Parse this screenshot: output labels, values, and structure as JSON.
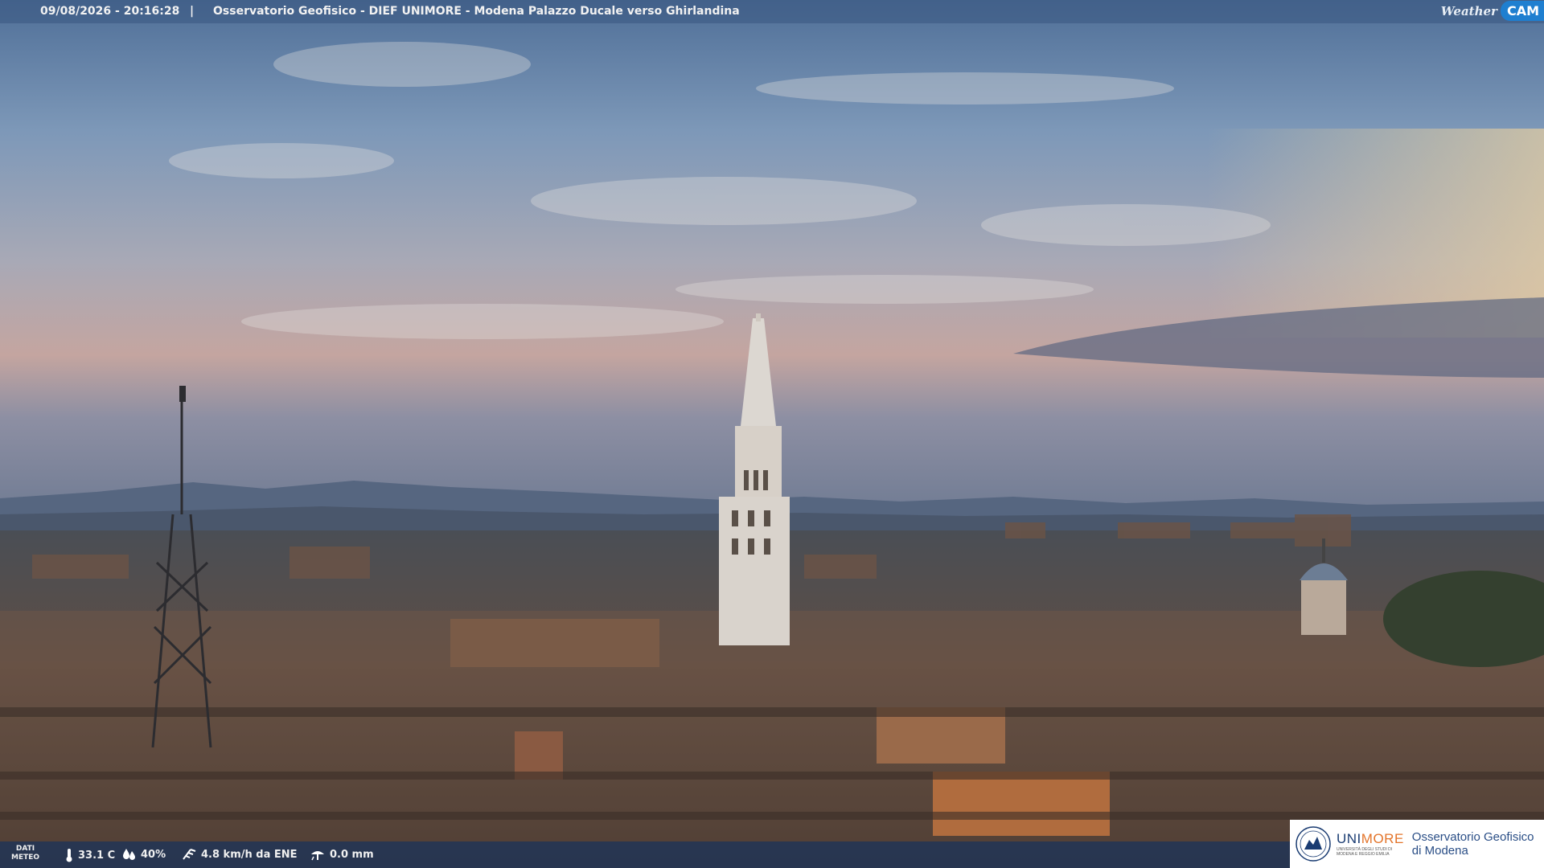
{
  "header": {
    "timestamp": "09/08/2026 - 20:16:28",
    "separator": "|",
    "title": "Osservatorio Geofisico - DIEF UNIMORE - Modena Palazzo Ducale verso Ghirlandina",
    "brand_word": "Weather",
    "brand_cam": "CAM"
  },
  "weather": {
    "label_line1": "DATI",
    "label_line2": "METEO",
    "temperature": "33.1 C",
    "humidity": "40%",
    "wind": "4.8 km/h da ENE",
    "rain": "0.0 mm"
  },
  "logo": {
    "uni_name_a": "UNI",
    "uni_name_b": "MORE",
    "uni_sub1": "UNIVERSITÀ DEGLI STUDI DI",
    "uni_sub2": "MODENA E REGGIO EMILIA",
    "obs_line1": "Osservatorio Geofisico",
    "obs_line2": "di Modena"
  },
  "colors": {
    "sky_top": "#5a7aa0",
    "sky_horizon": "#c9a79e",
    "brand_blue": "#1f7fd0",
    "unimore_orange": "#e3742a"
  }
}
